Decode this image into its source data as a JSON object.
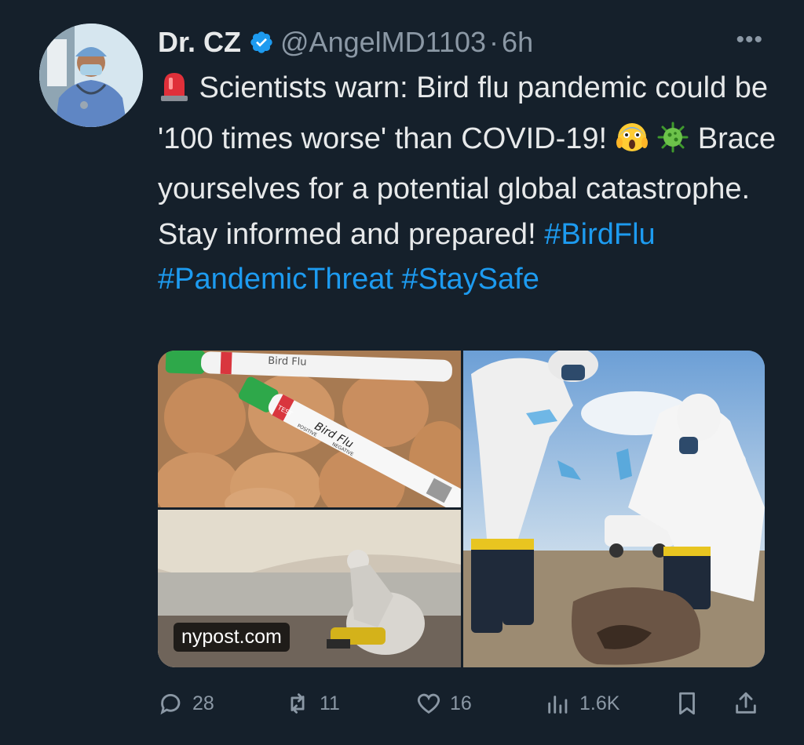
{
  "author": {
    "name": "Dr. CZ",
    "handle": "@AngelMD1103",
    "separator": "·",
    "time": "6h",
    "verified": true
  },
  "tweet": {
    "text_1": " Scientists warn: Bird flu pandemic could be '100 times worse' than COVID-19! ",
    "text_2": " Brace yourselves for a potential global catastrophe. Stay informed and prepared! ",
    "hashtags": [
      "#BirdFlu",
      "#PandemicThreat",
      "#StaySafe"
    ],
    "emojis": [
      "police-car-light",
      "face-screaming-in-fear",
      "microbe"
    ]
  },
  "media": {
    "source": "nypost.com",
    "tube_label_1": "Bird Flu",
    "tube_label_2": "Bird Flu",
    "tube_positive": "POSITIVE",
    "tube_negative": "NEGATIVE",
    "tube_test": "TEST"
  },
  "actions": {
    "replies": "28",
    "retweets": "11",
    "likes": "16",
    "views": "1.6K"
  },
  "colors": {
    "background": "#15202b",
    "text": "#e7e9ea",
    "secondary": "#8b98a5",
    "accent": "#1d9bf0"
  }
}
